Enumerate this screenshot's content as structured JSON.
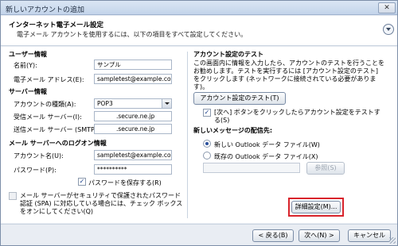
{
  "window": {
    "title": "新しいアカウントの追加",
    "close_label": "✕"
  },
  "header": {
    "title": "インターネット電子メール設定",
    "description": "電子メール アカウントを使用するには、以下の項目をすべて設定してください。"
  },
  "user_info": {
    "section": "ユーザー情報",
    "name_label": "名前(Y):",
    "name_value": "サンプル",
    "email_label": "電子メール アドレス(E):",
    "email_value": "sampletest@example.com"
  },
  "server_info": {
    "section": "サーバー情報",
    "account_type_label": "アカウントの種類(A):",
    "account_type_value": "POP3",
    "incoming_label": "受信メール サーバー(I):",
    "incoming_value": ".secure.ne.jp",
    "outgoing_label": "送信メール サーバー (SMTP)(O):",
    "outgoing_value": ".secure.ne.jp"
  },
  "logon_info": {
    "section": "メール サーバーへのログオン情報",
    "account_name_label": "アカウント名(U):",
    "account_name_value": "sampletest@example.com",
    "password_label": "パスワード(P):",
    "password_value": "**********",
    "save_password_label": "パスワードを保存する(R)",
    "spa_label": "メール サーバーがセキュリティで保護されたパスワード認証 (SPA) に対応している場合には、チェック ボックスをオンにしてください(Q)"
  },
  "test": {
    "section": "アカウント設定のテスト",
    "description": "この画面内に情報を入力したら、アカウントのテストを行うことをお勧めします。テストを実行するには [アカウント設定のテスト] をクリックします (ネットワークに接続されている必要があります)。",
    "test_button": "アカウント設定のテスト(T)",
    "auto_test_label": "[次へ] ボタンをクリックしたらアカウント設定をテストする(S)"
  },
  "delivery": {
    "section": "新しいメッセージの配信先:",
    "new_file_label": "新しい Outlook データ ファイル(W)",
    "existing_file_label": "既存の Outlook データ ファイル(X)",
    "browse_button": "参照(S)"
  },
  "more_settings_button": "詳細設定(M)...",
  "footer": {
    "back_button": "< 戻る(B)",
    "next_button": "次へ(N) >",
    "cancel_button": "キャンセル"
  },
  "colors": {
    "highlight": "#d9242c",
    "window_bg": "#e9edf3"
  }
}
